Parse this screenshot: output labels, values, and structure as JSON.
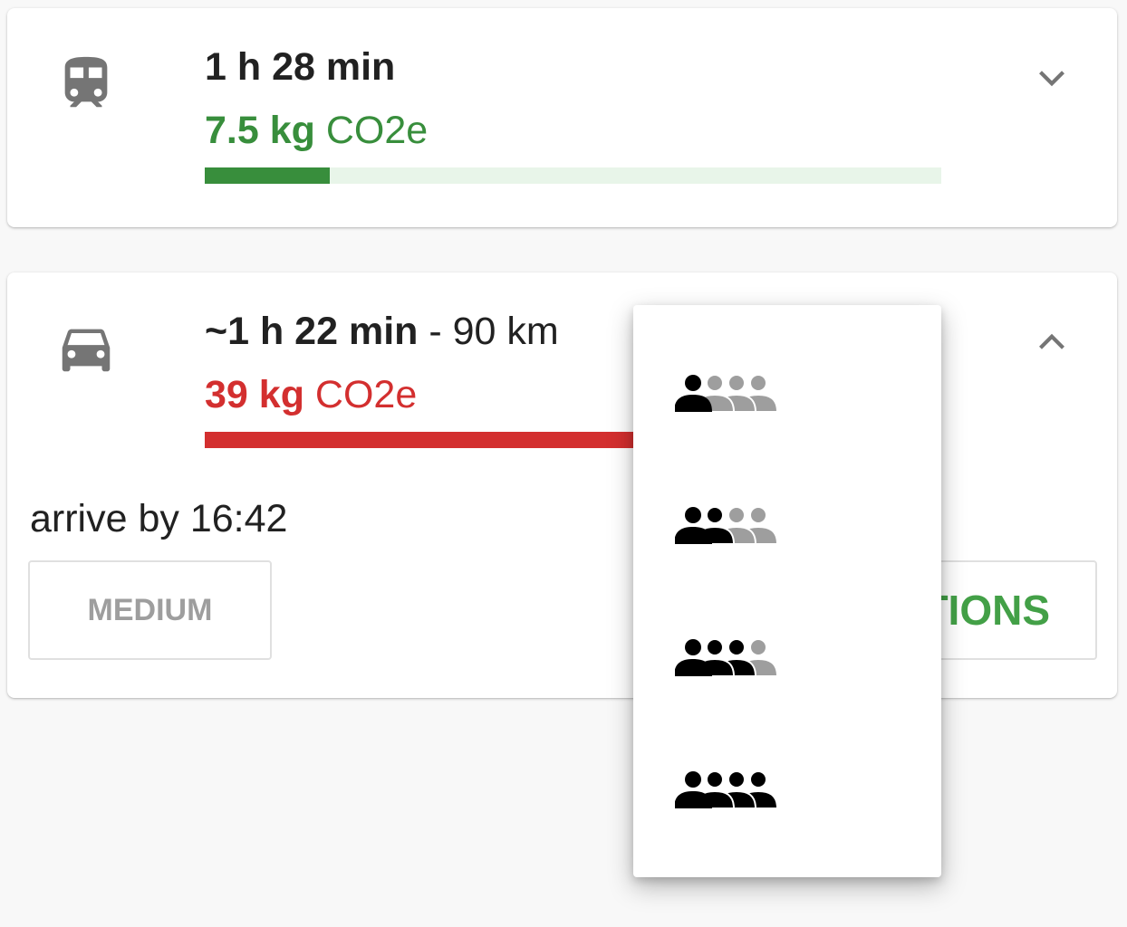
{
  "routes": [
    {
      "mode_icon": "train-icon",
      "duration": "1 h 28 min",
      "distance_sep": "",
      "distance": "",
      "emission_amount": "7.5 kg",
      "emission_unit": "CO2e",
      "emission_color": "#388e3c",
      "bar_fill_fraction": 0.17,
      "bar_fill_color": "#388e3c",
      "bar_track_color": "#e8f5e9",
      "chevron": "chevron-down-icon"
    },
    {
      "mode_icon": "car-icon",
      "duration": "~1 h 22 min",
      "distance_sep": " - ",
      "distance": "90 km",
      "emission_amount": "39 kg",
      "emission_unit": "CO2e",
      "emission_color": "#d32f2f",
      "bar_fill_fraction": 1.0,
      "bar_fill_color": "#d32f2f",
      "bar_track_color": "#d32f2f",
      "chevron": "chevron-up-icon",
      "arrive": "arrive by 16:42",
      "medium_button": "MEDIUM",
      "options_button": "TIONS"
    }
  ],
  "passenger_menu": {
    "options": [
      {
        "icon": "one-passenger-icon",
        "passengers": 1,
        "max": 4
      },
      {
        "icon": "two-passengers-icon",
        "passengers": 2,
        "max": 4
      },
      {
        "icon": "three-passengers-icon",
        "passengers": 3,
        "max": 4
      },
      {
        "icon": "four-passengers-icon",
        "passengers": 4,
        "max": 4
      }
    ],
    "active_color": "#000000",
    "inactive_color": "#9e9e9e"
  },
  "colors": {
    "icon_gray": "#757575",
    "chevron_gray": "#757575"
  }
}
